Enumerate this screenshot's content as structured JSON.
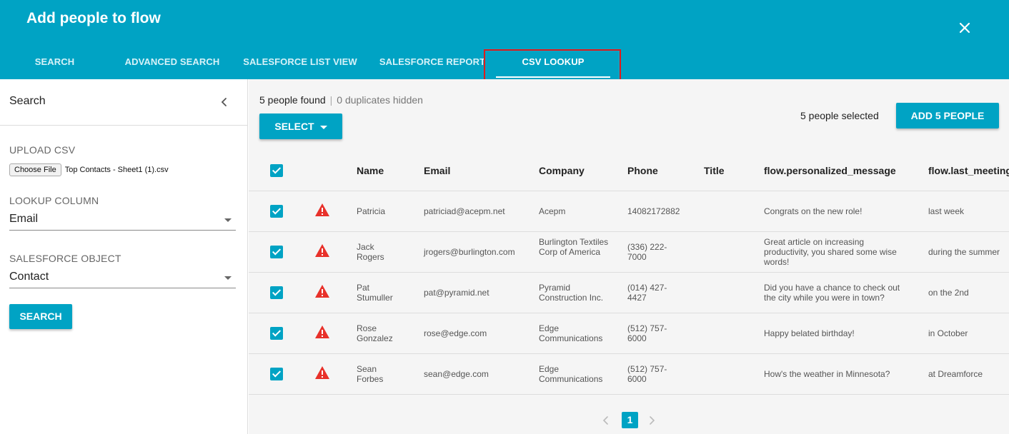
{
  "header": {
    "title": "Add people to flow",
    "tabs": [
      {
        "label": "SEARCH"
      },
      {
        "label": "ADVANCED SEARCH"
      },
      {
        "label": "SALESFORCE LIST VIEW"
      },
      {
        "label": "SALESFORCE REPORT"
      },
      {
        "label": "CSV LOOKUP"
      }
    ],
    "active_tab": "CSV LOOKUP"
  },
  "sidebar": {
    "title": "Search",
    "upload_label": "UPLOAD CSV",
    "file_button": "Choose File",
    "file_name": "Top Contacts - Sheet1 (1).csv",
    "lookup_label": "LOOKUP COLUMN",
    "lookup_value": "Email",
    "object_label": "SALESFORCE OBJECT",
    "object_value": "Contact",
    "search_button": "SEARCH"
  },
  "results": {
    "found": "5 people found",
    "duplicates": "0 duplicates hidden",
    "select_button": "SELECT",
    "selected_text": "5 people selected",
    "add_button": "ADD 5 PEOPLE"
  },
  "table": {
    "columns": [
      "Name",
      "Email",
      "Company",
      "Phone",
      "Title",
      "flow.personalized_message",
      "flow.last_meeting"
    ],
    "rows": [
      {
        "name": "Patricia",
        "email": "patriciad@acepm.net",
        "company": "Acepm",
        "phone": "14082172882",
        "title": "",
        "message": "Congrats on the new role!",
        "last_meeting": "last week"
      },
      {
        "name": "Jack Rogers",
        "email": "jrogers@burlington.com",
        "company": "Burlington Textiles Corp of America",
        "phone": "(336) 222-7000",
        "title": "",
        "message": "Great article on increasing productivity, you shared some wise words!",
        "last_meeting": "during the summer"
      },
      {
        "name": "Pat Stumuller",
        "email": "pat@pyramid.net",
        "company": "Pyramid Construction Inc.",
        "phone": "(014) 427-4427",
        "title": "",
        "message": "Did you have a chance to check out the city while you were in town?",
        "last_meeting": "on the 2nd"
      },
      {
        "name": "Rose Gonzalez",
        "email": "rose@edge.com",
        "company": "Edge Communications",
        "phone": "(512) 757-6000",
        "title": "",
        "message": "Happy belated birthday!",
        "last_meeting": "in October"
      },
      {
        "name": "Sean Forbes",
        "email": "sean@edge.com",
        "company": "Edge Communications",
        "phone": "(512) 757-6000",
        "title": "",
        "message": "How's the weather in Minnesota?",
        "last_meeting": "at Dreamforce"
      }
    ]
  },
  "pagination": {
    "current_page": "1"
  },
  "colors": {
    "accent": "#00a3c4",
    "warning": "#e8312a",
    "highlight": "#e01b1b"
  },
  "icons": [
    "close-icon",
    "chevron-left-icon",
    "caret-down-icon",
    "checkbox-checked-icon",
    "warning-icon",
    "chevron-right-icon"
  ]
}
